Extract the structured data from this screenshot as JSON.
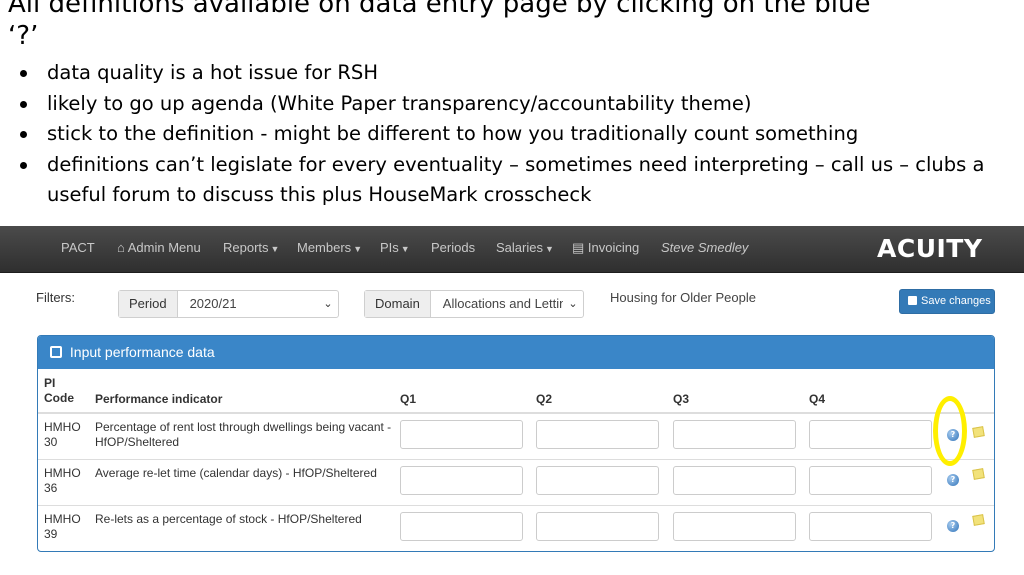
{
  "slide": {
    "title": "All definitions available on data entry page by clicking on the blue ‘?’",
    "bullets": [
      "data quality is a hot issue for RSH",
      "likely to go up agenda (White Paper transparency/accountability theme)",
      "stick to the definition - might be different to how you traditionally count something",
      "definitions can’t legislate for every eventuality – sometimes need interpreting – call us – clubs a useful forum to discuss this plus HouseMark crosscheck"
    ]
  },
  "navbar": {
    "brand": "PACT",
    "admin_menu": "Admin Menu",
    "reports": "Reports",
    "members": "Members",
    "pis": "PIs",
    "periods": "Periods",
    "salaries": "Salaries",
    "invoicing": "Invoicing",
    "user": "Steve Smedley",
    "logo": "ACUITY"
  },
  "filters": {
    "label": "Filters:",
    "period_label": "Period",
    "period_value": "2020/21",
    "domain_label": "Domain",
    "domain_value": "Allocations and Lettings",
    "housing_label": "Housing for Older People",
    "save_label": "Save changes"
  },
  "panel": {
    "title": "Input performance data",
    "columns": {
      "code_line1": "PI",
      "code_line2": "Code",
      "indicator": "Performance indicator",
      "q1": "Q1",
      "q2": "Q2",
      "q3": "Q3",
      "q4": "Q4"
    },
    "rows": [
      {
        "code_line1": "HMHO",
        "code_line2": "30",
        "indicator": "Percentage of rent lost through dwellings being vacant - HfOP/Sheltered"
      },
      {
        "code_line1": "HMHO",
        "code_line2": "36",
        "indicator": "Average re-let time (calendar days) - HfOP/Sheltered"
      },
      {
        "code_line1": "HMHO",
        "code_line2": "39",
        "indicator": "Re-lets as a percentage of stock - HfOP/Sheltered"
      }
    ]
  },
  "icons": {
    "help": "question-circle-icon",
    "note": "note-icon",
    "home": "home-icon",
    "invoice": "invoice-icon",
    "edit": "edit-icon",
    "save": "floppy-disk-icon"
  },
  "colors": {
    "navbar": "#3a3a3a",
    "panel_header": "#3a86c8",
    "save_button": "#337ab7",
    "highlight": "#ffef00"
  }
}
